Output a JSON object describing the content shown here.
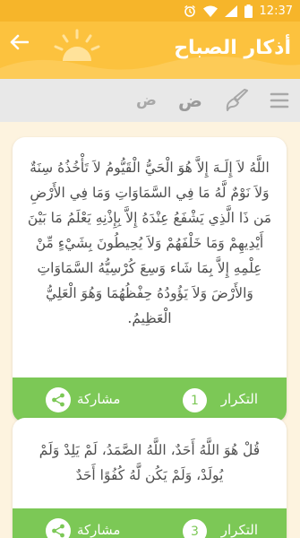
{
  "status_bar": {
    "time": "12:37"
  },
  "header": {
    "title": "أذكار الصباح"
  },
  "toolbar": {
    "font_increase": "ض",
    "font_decrease": "ض"
  },
  "cards": [
    {
      "text": "اللَّهُ لاَ إِلَـهَ إِلاَّ هُوَ الْحَيُّ الْقَيُّومُ لاَ تَأْخُذُهُ سِنَةٌ وَلاَ نَوْمٌ لَّهُ مَا فِي السَّمَاوَاتِ وَمَا فِي الأَرْضِ مَن ذَا الَّذِي يَشْفَعُ عِنْدَهُ إِلاَّ بِإِذْنِهِ يَعْلَمُ مَا بَيْنَ أَيْدِيهِمْ وَمَا خَلْفَهُمْ وَلاَ يُحِيطُونَ بِشَيْءٍ مِّنْ عِلْمِهِ إِلاَّ بِمَا شَاء وَسِعَ كُرْسِيُّهُ السَّمَاوَاتِ وَالأَرْضَ وَلاَ يَؤُودُهُ حِفْظُهُمَا وَهُوَ الْعَلِيُّ الْعَظِيمُ.",
      "repeat_label": "التكرار",
      "count": "1",
      "share_label": "مشاركة"
    },
    {
      "text": "قُلْ هُوَ اللَّهُ أَحَدٌ، اللَّهُ الصَّمَدُ، لَمْ يَلِدْ وَلَمْ يُولَدْ، وَلَمْ يَكُن لَّهُ كُفُوًا أَحَدٌ",
      "repeat_label": "التكرار",
      "count": "3",
      "share_label": "مشاركة"
    }
  ],
  "colors": {
    "status_bar": "#f6b52a",
    "header": "#fcc23e",
    "card_footer": "#7cc856",
    "background": "#fdf3df"
  },
  "icons": {
    "back": "arrow-left-icon",
    "header_art": "sun-icon",
    "menu": "hamburger-menu-icon",
    "brush": "brush-icon",
    "share": "share-icon"
  }
}
